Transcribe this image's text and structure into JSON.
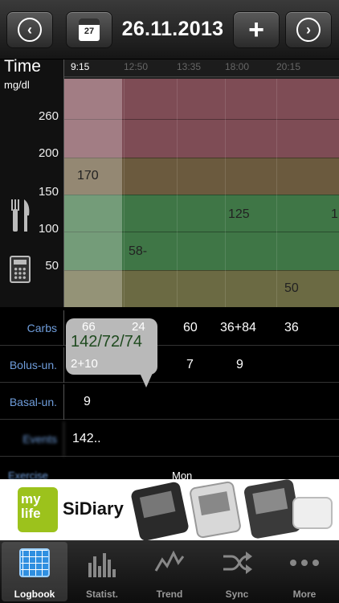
{
  "toolbar": {
    "back_icon": "chevron-left-icon",
    "calendar_day": "27",
    "date": "26.11.2013",
    "add_icon": "plus-icon",
    "forward_icon": "chevron-right-icon"
  },
  "chart": {
    "axis_title": "Time",
    "unit": "mg/dl",
    "y_ticks": [
      "260",
      "200",
      "150",
      "100",
      "50"
    ],
    "times": [
      "9:15",
      "12:50",
      "13:35",
      "18:00",
      "20:15"
    ],
    "readings": [
      "170",
      "125",
      "58-",
      "50",
      "1"
    ],
    "colors": {
      "high": "#7e4c55",
      "elevated": "#6b5a3e",
      "normal": "#3f7646",
      "low": "#6b6a43"
    }
  },
  "rows": [
    {
      "label": "Carbs",
      "values": [
        "66",
        "24",
        "60",
        "36+84",
        "36"
      ]
    },
    {
      "label": "Bolus-un.",
      "values": [
        "2+10",
        "7",
        "9"
      ]
    },
    {
      "label": "Basal-un.",
      "values": [
        "9"
      ]
    },
    {
      "label": "Events",
      "values": [
        "142.."
      ]
    }
  ],
  "popup": {
    "top_left": "66",
    "top_right": "24",
    "main": "142/72/74",
    "bottom": "2+10"
  },
  "partial": {
    "left": "Exercise",
    "center": "Mon"
  },
  "ad": {
    "logo_line1": "my",
    "logo_line2": "life",
    "title": "SiDiary"
  },
  "tabs": [
    {
      "label": "Logbook",
      "icon": "logbook-grid-icon"
    },
    {
      "label": "Statist.",
      "icon": "statistics-bars-icon"
    },
    {
      "label": "Trend",
      "icon": "trend-line-icon"
    },
    {
      "label": "Sync",
      "icon": "sync-shuffle-icon"
    },
    {
      "label": "More",
      "icon": "more-dots-icon"
    }
  ]
}
